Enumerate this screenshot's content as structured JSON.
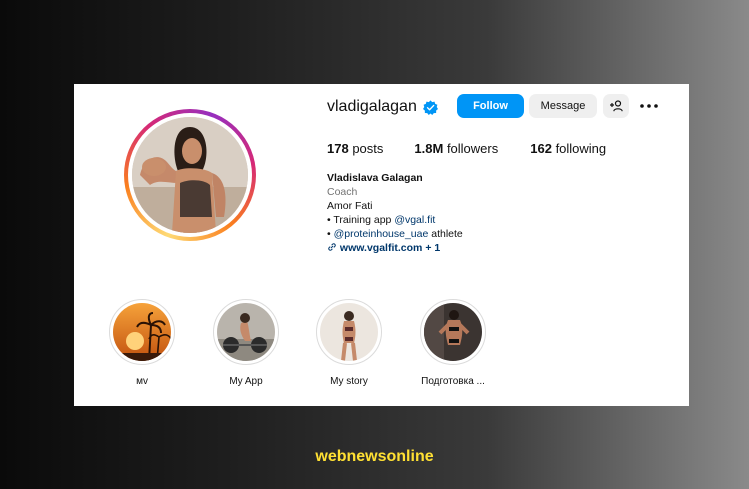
{
  "profile": {
    "username": "vladigalagan",
    "follow_label": "Follow",
    "message_label": "Message",
    "add_user_icon": "add-user-icon",
    "more_icon": "more-options-icon",
    "verified_icon": "verified-badge-icon"
  },
  "stats": {
    "posts_count": "178",
    "posts_label": "posts",
    "followers_count": "1.8M",
    "followers_label": "followers",
    "following_count": "162",
    "following_label": "following"
  },
  "bio": {
    "name": "Vladislava Galagan",
    "category": "Coach",
    "line1": "Amor Fati",
    "line2_prefix": "• Training app ",
    "line2_mention": "@vgal.fit",
    "line3_prefix": "• ",
    "line3_mention": "@proteinhouse_uae",
    "line3_suffix": " athlete",
    "link_text": "www.vgalfit.com",
    "link_extra": "+ 1"
  },
  "highlights": [
    {
      "label": "мv"
    },
    {
      "label": "My App"
    },
    {
      "label": "My story"
    },
    {
      "label": "Подготовка ..."
    }
  ],
  "footer": {
    "watermark": "webnewsonline"
  },
  "colors": {
    "follow_blue": "#0095f6",
    "verified_blue": "#0095f6",
    "watermark_yellow": "#ffe033"
  }
}
